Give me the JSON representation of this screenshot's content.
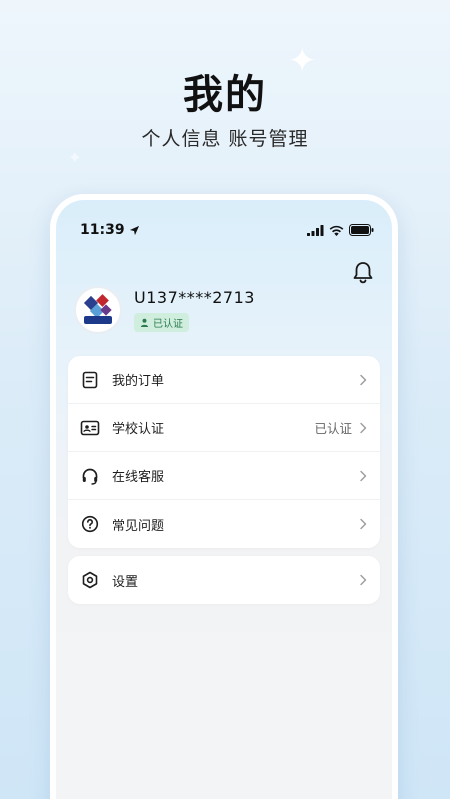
{
  "hero": {
    "title": "我的",
    "subtitle": "个人信息 账号管理"
  },
  "status_bar": {
    "time": "11:39"
  },
  "profile": {
    "username": "U137****2713",
    "badge": "已认证"
  },
  "menu": {
    "items": [
      {
        "label": "我的订单",
        "value": "",
        "icon": "order-icon"
      },
      {
        "label": "学校认证",
        "value": "已认证",
        "icon": "id-card-icon"
      },
      {
        "label": "在线客服",
        "value": "",
        "icon": "headset-icon"
      },
      {
        "label": "常见问题",
        "value": "",
        "icon": "question-icon"
      }
    ]
  },
  "settings": {
    "label": "设置",
    "icon": "settings-icon"
  },
  "colors": {
    "badge_bg": "#cfeedd",
    "badge_text": "#2d7a4e",
    "background": "#dcecf8"
  }
}
